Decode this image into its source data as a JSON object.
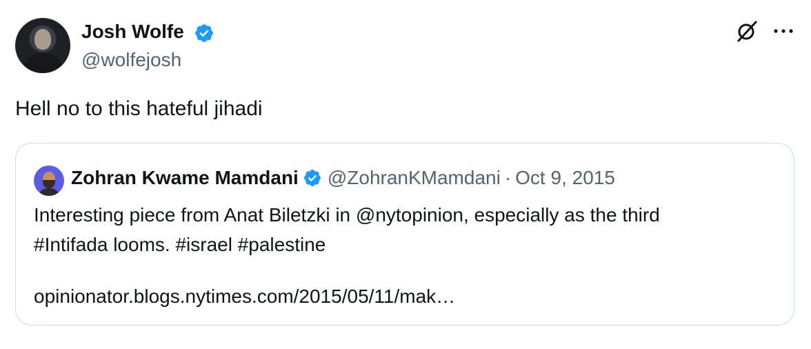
{
  "tweet": {
    "author_name": "Josh Wolfe",
    "author_handle": "@wolfejosh",
    "text": "Hell no to this hateful jihadi"
  },
  "quote": {
    "author_name": "Zohran Kwame Mamdani",
    "author_handle": "@ZohranKMamdani",
    "separator": "·",
    "date": "Oct 9, 2015",
    "text_line1": "Interesting piece from Anat Biletzki in @nytopinion, especially as the third",
    "text_line2": "#Intifada looms. #israel #palestine",
    "link": "opinionator.blogs.nytimes.com/2015/05/11/mak…"
  },
  "icons": {
    "verified": "verified-badge-icon",
    "grok": "grok-icon",
    "more": "more-icon"
  },
  "colors": {
    "verified": "#1d9bf0",
    "secondary_text": "#536471",
    "border": "#cfd9de"
  }
}
